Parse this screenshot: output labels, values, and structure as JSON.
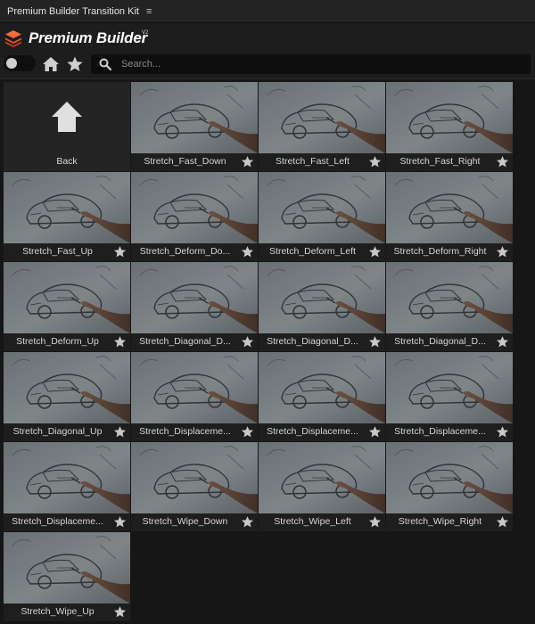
{
  "panel": {
    "title": "Premium Builder Transition Kit",
    "menu_glyph": "≡"
  },
  "brand": {
    "name": "Premium Builder",
    "version": "V2",
    "logo_icon": "layers-stack-icon",
    "accent": "#e8542e"
  },
  "toolbar": {
    "toggle_icon": "toggle-switch-icon",
    "home_icon": "home-icon",
    "favorites_icon": "star-icon",
    "search": {
      "icon": "search-icon",
      "placeholder": "Search...",
      "value": ""
    }
  },
  "back": {
    "label": "Back",
    "icon": "arrow-up-icon"
  },
  "items": [
    {
      "label": "Stretch_Fast_Down"
    },
    {
      "label": "Stretch_Fast_Left"
    },
    {
      "label": "Stretch_Fast_Right"
    },
    {
      "label": "Stretch_Fast_Up"
    },
    {
      "label": "Stretch_Deform_Do..."
    },
    {
      "label": "Stretch_Deform_Left"
    },
    {
      "label": "Stretch_Deform_Right"
    },
    {
      "label": "Stretch_Deform_Up"
    },
    {
      "label": "Stretch_Diagonal_D..."
    },
    {
      "label": "Stretch_Diagonal_D..."
    },
    {
      "label": "Stretch_Diagonal_D..."
    },
    {
      "label": "Stretch_Diagonal_Up"
    },
    {
      "label": "Stretch_Displaceme..."
    },
    {
      "label": "Stretch_Displaceme..."
    },
    {
      "label": "Stretch_Displaceme..."
    },
    {
      "label": "Stretch_Displaceme..."
    },
    {
      "label": "Stretch_Wipe_Down"
    },
    {
      "label": "Stretch_Wipe_Left"
    },
    {
      "label": "Stretch_Wipe_Right"
    },
    {
      "label": "Stretch_Wipe_Up"
    }
  ]
}
